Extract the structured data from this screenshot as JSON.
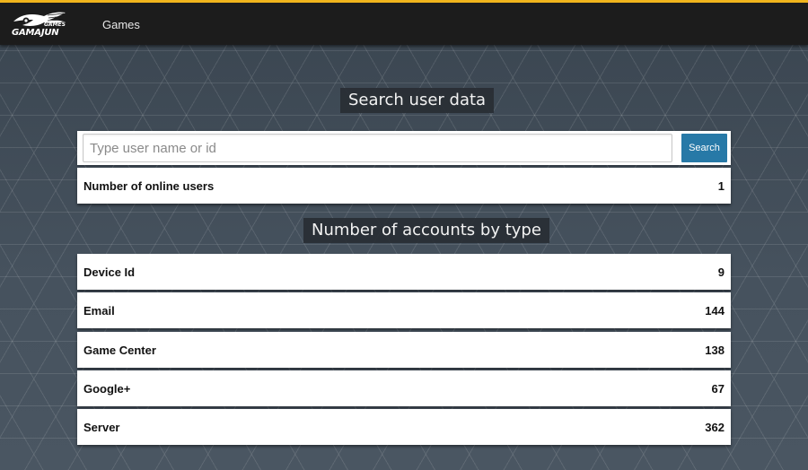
{
  "header": {
    "logo": {
      "brand": "GAMAJUN",
      "sub": "GAMES"
    },
    "nav": {
      "games_label": "Games"
    },
    "accent_color": "#f0b41c"
  },
  "search": {
    "title": "Search user data",
    "placeholder": "Type user name or id",
    "button_label": "Search",
    "button_color": "#2779a7"
  },
  "online": {
    "label": "Number of online users",
    "value": "1"
  },
  "accounts": {
    "title": "Number of accounts by type",
    "rows": [
      {
        "label": "Device Id",
        "value": "9"
      },
      {
        "label": "Email",
        "value": "144"
      },
      {
        "label": "Game Center",
        "value": "138"
      },
      {
        "label": "Google+",
        "value": "67"
      },
      {
        "label": "Server",
        "value": "362"
      }
    ]
  }
}
